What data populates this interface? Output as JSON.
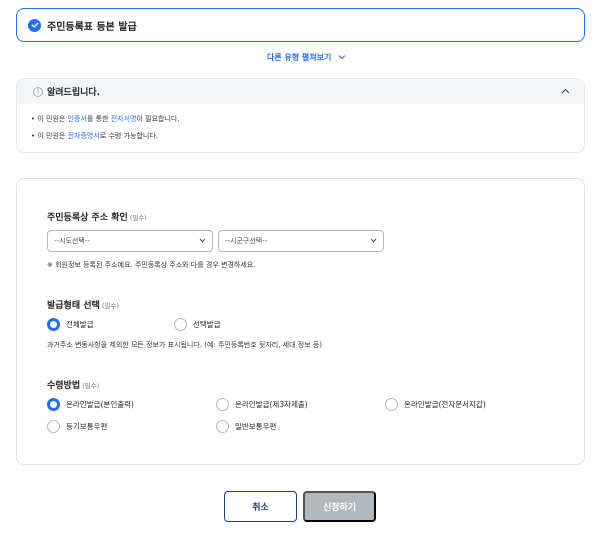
{
  "service": {
    "title": "주민등록표 등본 발급"
  },
  "more_types": {
    "label": "다른 유형 펼쳐보기"
  },
  "notice": {
    "title": "알려드립니다.",
    "line1": {
      "bullet": "•",
      "pre": "이 민원은 ",
      "hl1": "인증서",
      "mid": "를 통한 ",
      "hl2": "전자서명",
      "post": "이 필요합니다."
    },
    "line2": {
      "bullet": "•",
      "pre": "이 민원은 ",
      "hl1": "전자증명서",
      "post": "로 수령 가능합니다."
    }
  },
  "address": {
    "title": "주민등록상 주소 확인",
    "required": "(필수)",
    "sido_placeholder": "--시도선택--",
    "sigungu_placeholder": "--시군구선택--",
    "help": "※ 회원정보 등록된 주소예요. 주민등록상 주소와 다를 경우 변경하세요."
  },
  "issue_type": {
    "title": "발급형태 선택",
    "required": "(필수)",
    "options": [
      {
        "label": "전체발급",
        "selected": true
      },
      {
        "label": "선택발급",
        "selected": false
      }
    ],
    "help": "과거주소 변동사항을 제외한 모든 정보가 표시됩니다. (예: 주민등록번호 뒷자리, 세대 정보 등)"
  },
  "receive": {
    "title": "수령방법",
    "required": "(필수)",
    "options": [
      {
        "label": "온라인발급(본인출력)",
        "selected": true
      },
      {
        "label": "온라인발급(제3자제출)",
        "selected": false
      },
      {
        "label": "온라인발급(전자문서지갑)",
        "selected": false
      },
      {
        "label": "등기보통우편",
        "selected": false
      },
      {
        "label": "일반보통우편",
        "selected": false
      }
    ]
  },
  "buttons": {
    "cancel": "취소",
    "submit": "신청하기"
  },
  "colors": {
    "primary": "#256ef4",
    "navy": "#1d3f7a",
    "disabled": "#b1b8be"
  }
}
